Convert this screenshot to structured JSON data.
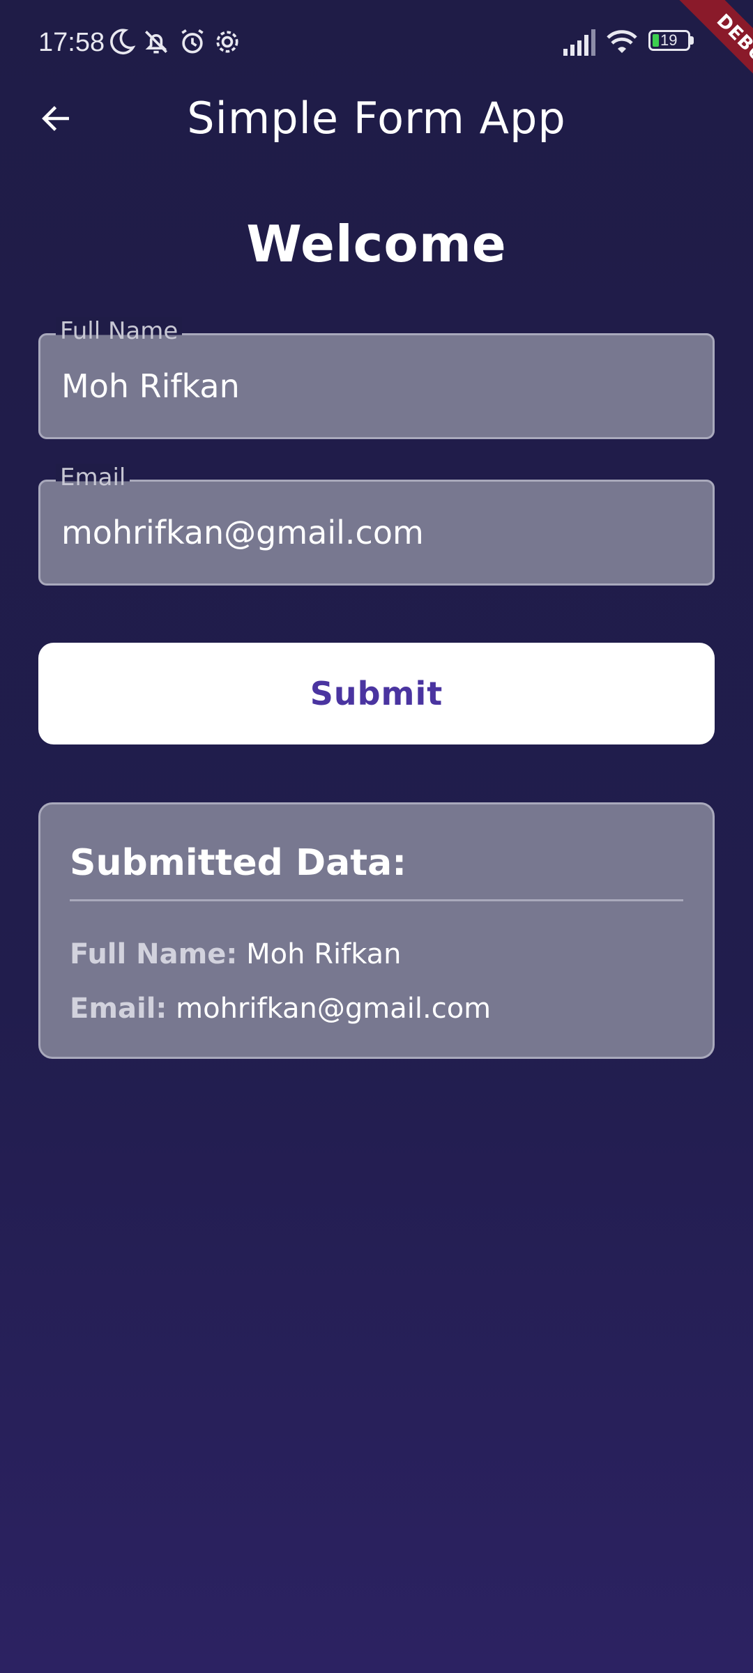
{
  "status_bar": {
    "time": "17:58",
    "icons": [
      "moon-icon",
      "bell-off-icon",
      "alarm-icon",
      "settings-gear-icon"
    ],
    "right_icons": [
      "signal-icon",
      "wifi-icon",
      "battery-icon"
    ],
    "battery_level": "19"
  },
  "debug_banner": "DEBUG",
  "app_bar": {
    "back_icon": "arrow-left-icon",
    "title": "Simple Form App"
  },
  "form": {
    "heading": "Welcome",
    "fields": [
      {
        "label": "Full Name",
        "value": "Moh Rifkan"
      },
      {
        "label": "Email",
        "value": "mohrifkan@gmail.com"
      }
    ],
    "submit_label": "Submit"
  },
  "submitted": {
    "title": "Submitted Data:",
    "rows": [
      {
        "key": "Full Name:",
        "value": "Moh Rifkan"
      },
      {
        "key": "Email:",
        "value": "mohrifkan@gmail.com"
      }
    ]
  },
  "colors": {
    "background": "#211d4d",
    "field_fill": "#787890",
    "button_text": "#4a34a0",
    "debug_banner": "#8a1a2a"
  }
}
